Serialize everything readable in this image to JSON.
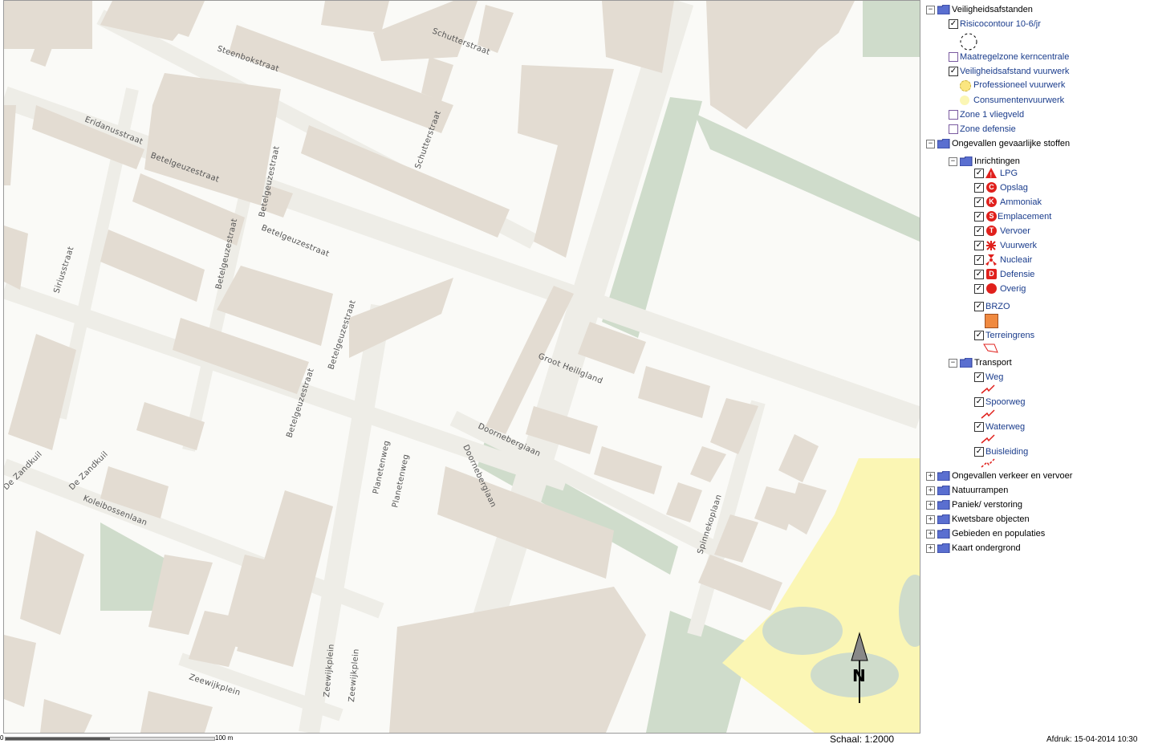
{
  "map": {
    "streets": [
      "Steenbokstraat",
      "Schutterstraat",
      "Schutterstraat",
      "Eridanusstraat",
      "Betelgeuzestraat",
      "Betelgeuzestraat",
      "Betelgeuzestraat",
      "Betelgeuzestraat",
      "Betelgeuzestraat",
      "Betelgeuzestraat",
      "Siriusstraat",
      "Groot Heiligland",
      "Doornebergiaan",
      "Doornebergiaan",
      "Planetenweg",
      "Planetenweg",
      "De Zandkuil",
      "De Zandkuil",
      "Koleibossenlaan",
      "Spinnekoplaan",
      "Zeewijkplein",
      "Zeewijkplein",
      "Zeewijkplein"
    ],
    "north_label": "N"
  },
  "legend": {
    "veiligheidsafstanden": "Veiligheidsafstanden",
    "risicocontour": "Risicocontour 10-6/jr",
    "maatregelzone": "Maatregelzone kerncentrale",
    "vuurwerk_afstand": "Veiligheidsafstand vuurwerk",
    "professioneel": "Professioneel vuurwerk",
    "consumenten": "Consumentenvuurwerk",
    "zone_vliegveld": "Zone 1 vliegveld",
    "zone_defensie": "Zone defensie",
    "ongevallen_gevaarlijk": "Ongevallen gevaarlijke stoffen",
    "inrichtingen": "Inrichtingen",
    "lpg": "LPG",
    "opslag": "Opslag",
    "ammoniak": "Ammoniak",
    "emplacement": "Emplacement",
    "vervoer": "Vervoer",
    "vuurwerk": "Vuurwerk",
    "nucleair": "Nucleair",
    "defensie": "Defensie",
    "overig": "Overig",
    "brzo": "BRZO",
    "terreingrens": "Terreingrens",
    "transport": "Transport",
    "weg": "Weg",
    "spoorweg": "Spoorweg",
    "waterweg": "Waterweg",
    "buisleiding": "Buisleiding",
    "ongevallen_verkeer": "Ongevallen verkeer en vervoer",
    "natuurrampen": "Natuurrampen",
    "paniek": "Paniek/ verstoring",
    "kwetsbare": "Kwetsbare objecten",
    "gebieden": "Gebieden en populaties",
    "kaart": "Kaart ondergrond",
    "icons": {
      "opslag": "C",
      "ammoniak": "K",
      "emplacement": "S",
      "vervoer": "T",
      "defensie": "D"
    }
  },
  "footer": {
    "scale_zero": "0",
    "scale_end": "100 m",
    "scale": "Schaal: 1:2000",
    "printed": "Afdruk: 15-04-2014 10:30"
  },
  "colors": {
    "building": "#e3dcd2",
    "road": "#f2f1ec",
    "green": "#cfdccb",
    "vuurwerk_zone": "#fbf6b4",
    "link": "#1a3c8c",
    "hazard_red": "#e0201c",
    "brzo": "#f08a40"
  }
}
